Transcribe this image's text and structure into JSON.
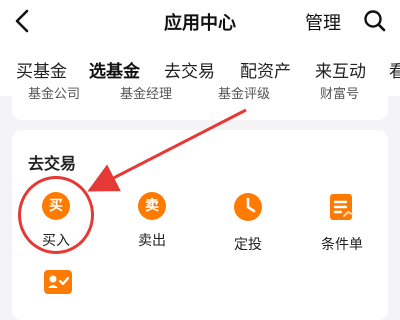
{
  "header": {
    "title": "应用中心",
    "manage_label": "管理",
    "back_icon": "chevron-left-icon",
    "search_icon": "search-icon"
  },
  "tabs": [
    {
      "label": "买基金",
      "active": false
    },
    {
      "label": "选基金",
      "active": true
    },
    {
      "label": "去交易",
      "active": false
    },
    {
      "label": "配资产",
      "active": false
    },
    {
      "label": "来互动",
      "active": false
    },
    {
      "label": "看",
      "active": false
    }
  ],
  "top_section": {
    "items": [
      "基金公司",
      "基金经理",
      "基金评级",
      "财富号"
    ]
  },
  "trade_section": {
    "title": "去交易",
    "items": [
      {
        "label": "买入",
        "icon_text": "买",
        "icon": "buy-icon"
      },
      {
        "label": "卖出",
        "icon_text": "卖",
        "icon": "sell-icon"
      },
      {
        "label": "定投",
        "icon": "clock-icon"
      },
      {
        "label": "条件单",
        "icon": "document-icon"
      }
    ]
  },
  "colors": {
    "accent": "#ff7a00",
    "indicator": "#ff6a00",
    "annotation": "#e53935",
    "background": "#f4f4f6"
  }
}
